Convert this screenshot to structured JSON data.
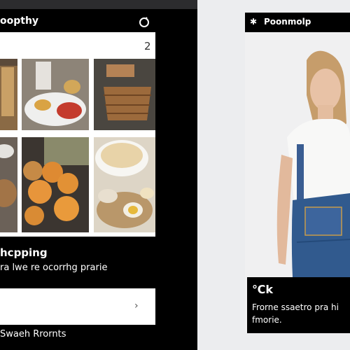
{
  "left_app": {
    "title": "oopthy",
    "page_indicator": "2",
    "heading": "hcpping",
    "subtext": "ra lwe re ocorrhg prarie",
    "footer": "Swaeh Rrornts",
    "input_chevron": "›",
    "colors": {
      "background": "#000000",
      "card": "#ffffff"
    },
    "icons": [
      "search-icon",
      "chevron-right-icon"
    ]
  },
  "right_app": {
    "header_title": "Poonmolp",
    "header_icon": "✱",
    "price": "℃k",
    "description": "Frorne ssaetro pra hi fmorie.",
    "colors": {
      "header": "#000000",
      "denim": "#2f4f82"
    }
  }
}
